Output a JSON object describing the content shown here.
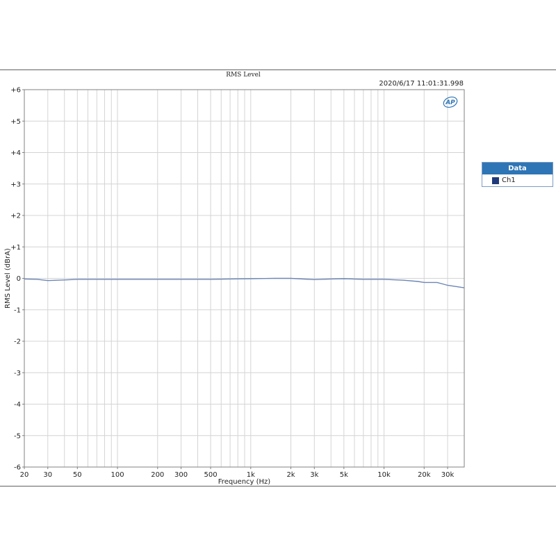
{
  "colors": {
    "series_line": "#6c86b6",
    "legend_swatch": "#1f3a7a",
    "legend_header": "#2e75b6",
    "grid": "#d4d4d4"
  },
  "header": {
    "timestamp": "2020/6/17 11:01:31.998"
  },
  "logo": {
    "text": "AP"
  },
  "legend": {
    "title": "Data",
    "entries": [
      {
        "label": "Ch1"
      }
    ]
  },
  "chart_data": {
    "type": "line",
    "title": "RMS Level",
    "xlabel": "Frequency (Hz)",
    "ylabel": "RMS Level (dBrA)",
    "xscale": "log",
    "xlim": [
      20,
      40000
    ],
    "ylim": [
      -6,
      6
    ],
    "grid": true,
    "legend_position": "right",
    "x_ticks": [
      {
        "value": 20,
        "label": "20"
      },
      {
        "value": 30,
        "label": "30"
      },
      {
        "value": 50,
        "label": "50"
      },
      {
        "value": 100,
        "label": "100"
      },
      {
        "value": 200,
        "label": "200"
      },
      {
        "value": 300,
        "label": "300"
      },
      {
        "value": 500,
        "label": "500"
      },
      {
        "value": 1000,
        "label": "1k"
      },
      {
        "value": 2000,
        "label": "2k"
      },
      {
        "value": 3000,
        "label": "3k"
      },
      {
        "value": 5000,
        "label": "5k"
      },
      {
        "value": 10000,
        "label": "10k"
      },
      {
        "value": 20000,
        "label": "20k"
      },
      {
        "value": 30000,
        "label": "30k"
      }
    ],
    "y_ticks": [
      {
        "value": 6,
        "label": "+6"
      },
      {
        "value": 5,
        "label": "+5"
      },
      {
        "value": 4,
        "label": "+4"
      },
      {
        "value": 3,
        "label": "+3"
      },
      {
        "value": 2,
        "label": "+2"
      },
      {
        "value": 1,
        "label": "+1"
      },
      {
        "value": 0,
        "label": "0"
      },
      {
        "value": -1,
        "label": "-1"
      },
      {
        "value": -2,
        "label": "-2"
      },
      {
        "value": -3,
        "label": "-3"
      },
      {
        "value": -4,
        "label": "-4"
      },
      {
        "value": -5,
        "label": "-5"
      },
      {
        "value": -6,
        "label": "-6"
      }
    ],
    "series": [
      {
        "name": "Ch1",
        "x": [
          20,
          25,
          30,
          40,
          50,
          60,
          80,
          100,
          150,
          200,
          300,
          500,
          700,
          1000,
          1500,
          2000,
          3000,
          4000,
          5000,
          7000,
          10000,
          14000,
          18000,
          20000,
          25000,
          30000,
          40000
        ],
        "y": [
          -0.02,
          -0.03,
          -0.07,
          -0.05,
          -0.03,
          -0.03,
          -0.03,
          -0.03,
          -0.03,
          -0.03,
          -0.03,
          -0.03,
          -0.02,
          -0.01,
          0.0,
          0.0,
          -0.04,
          -0.02,
          -0.01,
          -0.03,
          -0.03,
          -0.06,
          -0.1,
          -0.13,
          -0.13,
          -0.22,
          -0.3
        ]
      }
    ]
  }
}
